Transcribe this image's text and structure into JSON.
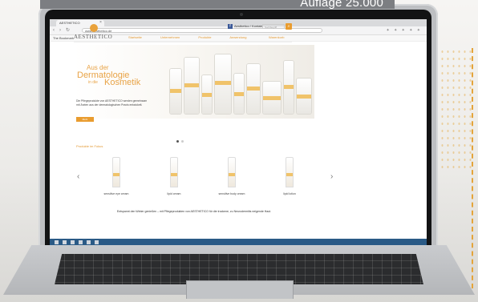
{
  "banner": {
    "text": "Auflage 25.000"
  },
  "browser": {
    "tab_title": "AESTHETICO",
    "url": "www.aesthetico.de",
    "bookmarks_label": "The Bookmark",
    "toolbar_icons": "✦ ✦ ✦ ✦ ✦"
  },
  "site": {
    "logo": "AESTHETICO",
    "social_text": "Aesthetico / Kontakt",
    "search_placeholder": "Suchbegriff",
    "menu": [
      "Startseite",
      "Unternehmen",
      "Produkte",
      "Anwendung"
    ],
    "cart": "Warenkorb",
    "hero": {
      "line1": "Aus der",
      "line2": "Dermatologie",
      "line3": "in die",
      "line4": "Kosmetik",
      "copy": "Die Pflegeprodukte von AESTHETICO werden gemeinsam mit Ärzten aus der dermatologischen Praxis entwickelt.",
      "button": "Mehr"
    },
    "products_title": "Produkte im Fokus",
    "products": [
      "sensitive eye cream",
      "lipid cream",
      "sensitive body cream",
      "lipid lotion"
    ],
    "tagline": "Entspannt den Winter genießen – mit Pflegeprodukten von AESTHETICO für die trockene, zu Neurodermitis neigende Haut."
  },
  "colors": {
    "accent": "#e99c2f",
    "taskbar": "#2a5a86",
    "banner": "#7c7e82"
  }
}
